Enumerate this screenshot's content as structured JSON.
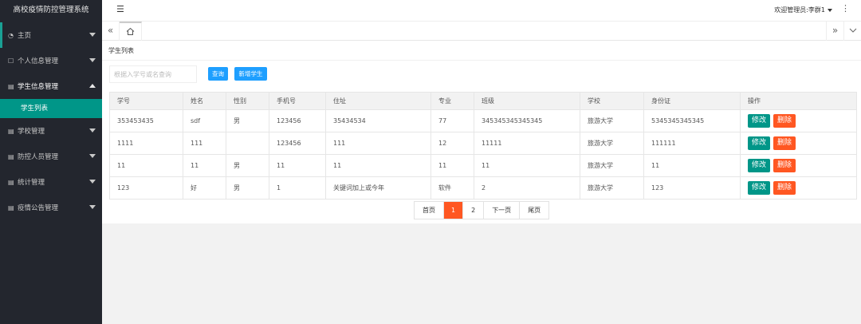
{
  "app": {
    "title": "高校疫情防控管理系统"
  },
  "sidebar": {
    "items": [
      {
        "label": "主页",
        "icon": "dashboard-icon"
      },
      {
        "label": "个人信息管理",
        "icon": "user-icon"
      },
      {
        "label": "学生信息管理",
        "icon": "doc-icon"
      },
      {
        "label": "学校管理",
        "icon": "doc-icon"
      },
      {
        "label": "防控人员管理",
        "icon": "doc-icon"
      },
      {
        "label": "统计管理",
        "icon": "doc-icon"
      },
      {
        "label": "疫情公告管理",
        "icon": "doc-icon"
      }
    ],
    "sub_item": "学生列表"
  },
  "header": {
    "user": "欢迎管理员:李群1"
  },
  "breadcrumb": "学生列表",
  "search": {
    "placeholder": "根据入学号或名查询",
    "search_label": "查询",
    "add_label": "新增学生"
  },
  "table": {
    "headers": [
      "学号",
      "姓名",
      "性别",
      "手机号",
      "住址",
      "专业",
      "班级",
      "学校",
      "身份证",
      "操作"
    ],
    "rows": [
      [
        "353453435",
        "sdf",
        "男",
        "123456",
        "35434534",
        "77",
        "345345345345345",
        "旅游大学",
        "5345345345345"
      ],
      [
        "1111",
        "111",
        "",
        "123456",
        "111",
        "12",
        "11111",
        "旅游大学",
        "111111"
      ],
      [
        "11",
        "11",
        "男",
        "11",
        "11",
        "11",
        "11",
        "旅游大学",
        "11"
      ],
      [
        "123",
        "好",
        "男",
        "1",
        "关键词加上或今年",
        "软件",
        "2",
        "旅游大学",
        "123"
      ]
    ],
    "edit_label": "修改",
    "delete_label": "删除"
  },
  "pagination": {
    "first": "首页",
    "pages": [
      "1",
      "2"
    ],
    "current": "1",
    "next": "下一页",
    "last": "尾页"
  },
  "colors": {
    "sidebar_bg": "#23262e",
    "accent": "#009688",
    "primary": "#1e9fff",
    "danger": "#ff5722"
  }
}
